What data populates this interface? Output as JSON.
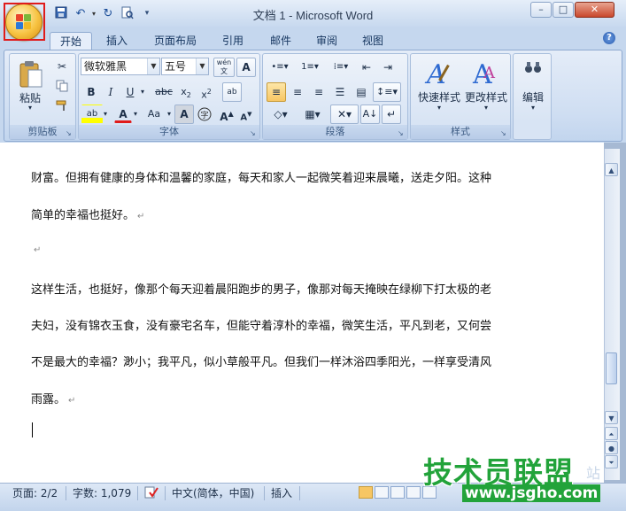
{
  "window": {
    "title": "文档 1 - Microsoft Word",
    "min_label": "–",
    "max_label": "□",
    "close_label": "✕"
  },
  "quick_access": {
    "icons": [
      "save-icon",
      "undo-icon",
      "redo-icon",
      "print-preview-icon",
      "customize-qat-icon"
    ]
  },
  "tabs": [
    {
      "label": "开始",
      "active": true
    },
    {
      "label": "插入",
      "active": false
    },
    {
      "label": "页面布局",
      "active": false
    },
    {
      "label": "引用",
      "active": false
    },
    {
      "label": "邮件",
      "active": false
    },
    {
      "label": "审阅",
      "active": false
    },
    {
      "label": "视图",
      "active": false
    }
  ],
  "ribbon": {
    "clipboard": {
      "paste_label": "粘贴",
      "group_label": "剪贴板"
    },
    "font": {
      "font_name": "微软雅黑",
      "font_size": "五号",
      "wen_label": "wén",
      "group_label": "字体"
    },
    "paragraph": {
      "group_label": "段落"
    },
    "styles": {
      "quick_styles_label": "快速样式",
      "change_styles_label": "更改样式",
      "group_label": "样式"
    },
    "editing": {
      "label": "编辑"
    }
  },
  "document": {
    "lines": [
      "财富。但拥有健康的身体和温馨的家庭，每天和家人一起微笑着迎来晨曦，送走夕阳。这种",
      "简单的幸福也挺好。",
      "",
      "这样生活，也挺好，像那个每天迎着晨阳跑步的男子，像那对每天掩映在绿柳下打太极的老",
      "夫妇，没有锦衣玉食，没有豪宅名车，但能守着淳朴的幸福，微笑生活，平凡到老，又何尝",
      "不是最大的幸福？渺小；我平凡，似小草般平凡。但我们一样沐浴四季阳光，一样享受清风",
      "雨露。"
    ],
    "paragraph_mark": "↵"
  },
  "status_bar": {
    "page": "页面: 2/2",
    "words": "字数: 1,079",
    "language": "中文(简体，中国)",
    "mode": "插入"
  },
  "watermark": {
    "main": "技术员联盟",
    "url": "www.jsgho.com",
    "tail": "站"
  },
  "colors": {
    "highlight_border": "#e01b1b",
    "accent": "#c5d7ee",
    "watermark_green": "#22a33a"
  }
}
